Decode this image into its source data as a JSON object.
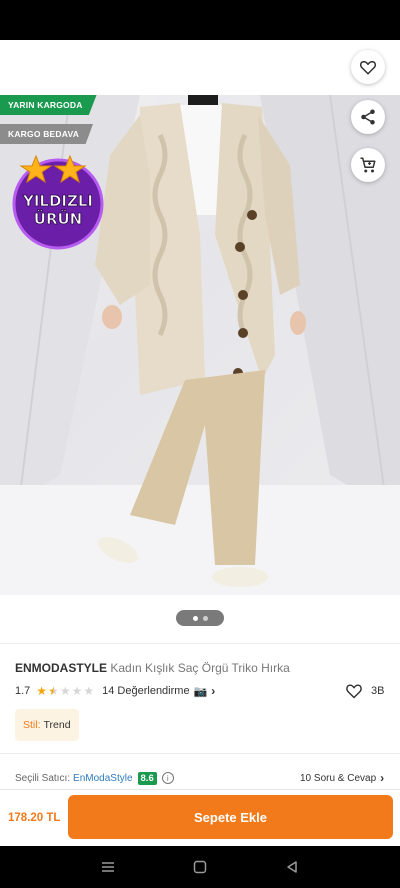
{
  "icons": {
    "back": "arrow-left-icon",
    "favorite": "heart-icon",
    "share": "share-icon",
    "cart": "cart-icon",
    "camera": "camera-icon",
    "info": "info-icon",
    "menu": "menu-icon",
    "home": "square-home-icon",
    "nav_back": "triangle-back-icon"
  },
  "badges": {
    "delivery": "YARIN KARGODA",
    "shipping": "KARGO BEDAVA",
    "star_line1": "YILDIZLI",
    "star_line2": "ÜRÜN"
  },
  "gallery": {
    "total_images": 2,
    "current_image": 1
  },
  "product": {
    "brand": "ENMODASTYLE",
    "name": "Kadın Kışlık Saç Örgü Triko Hırka",
    "rating": "1.7",
    "rating_value": 1.7,
    "review_text": "14 Değerlendirme",
    "camera_glyph": "📷",
    "favorite_count": "3B",
    "style_label": "Stil:",
    "style_value": "Trend"
  },
  "seller": {
    "label": "Seçili Satıcı:",
    "name": "EnModaStyle",
    "score": "8.6",
    "qa": "10 Soru & Cevap"
  },
  "cart": {
    "price": "178.20 TL",
    "button_label": "Sepete Ekle"
  },
  "colors": {
    "accent": "#f27a1a",
    "delivery_green": "#1a9a4f",
    "shipping_gray": "#8c8c8c",
    "star": "#f2a60c",
    "seller_link": "#2e7bbf"
  }
}
